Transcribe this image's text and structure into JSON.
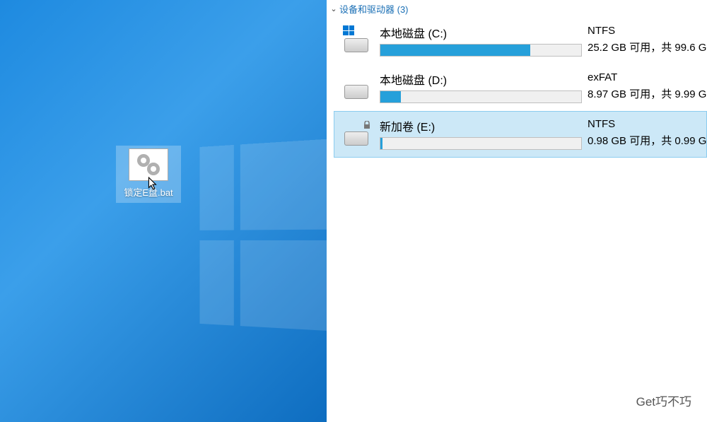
{
  "desktop": {
    "icon_label": "锁定E盘.bat"
  },
  "explorer": {
    "section_title": "设备和驱动器 (3)",
    "drives": [
      {
        "name": "本地磁盘 (C:)",
        "fs": "NTFS",
        "space": "25.2 GB 可用，共 99.6 G",
        "fill_percent": 74.7,
        "has_win_logo": true,
        "has_lock": false,
        "selected": false
      },
      {
        "name": "本地磁盘 (D:)",
        "fs": "exFAT",
        "space": "8.97 GB 可用，共 9.99 G",
        "fill_percent": 10.2,
        "has_win_logo": false,
        "has_lock": false,
        "selected": false
      },
      {
        "name": "新加卷 (E:)",
        "fs": "NTFS",
        "space": "0.98 GB 可用，共 0.99 G",
        "fill_percent": 1.0,
        "has_win_logo": false,
        "has_lock": true,
        "selected": true
      }
    ]
  },
  "watermark": "Get巧不巧"
}
